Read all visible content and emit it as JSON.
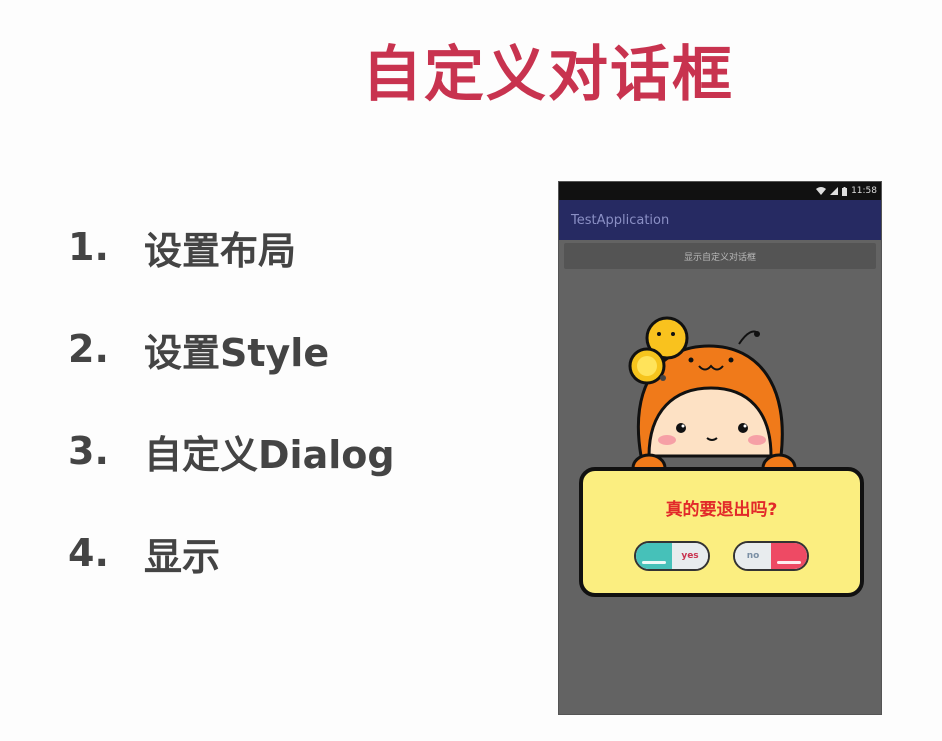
{
  "slide": {
    "title": "自定义对话框",
    "steps": [
      {
        "num": "1.",
        "text": "设置布局"
      },
      {
        "num": "2.",
        "text": "设置Style"
      },
      {
        "num": "3.",
        "text": "自定义Dialog"
      },
      {
        "num": "4.",
        "text": "显示"
      }
    ]
  },
  "phone": {
    "status_time": "11:58",
    "app_title": "TestApplication",
    "show_button_label": "显示自定义对话框",
    "dialog": {
      "message": "真的要退出吗?",
      "yes_label": "yes",
      "no_label": "no"
    }
  },
  "colors": {
    "title": "#c8334f",
    "app_bar": "#262a62",
    "dialog_bg": "#fbee80",
    "dialog_text": "#e2292a",
    "pill_teal": "#46c1b9",
    "pill_pink": "#ee4a64"
  },
  "icons": [
    "wifi-icon",
    "signal-icon",
    "battery-icon",
    "lightbulb-icon",
    "mascot-illustration"
  ]
}
